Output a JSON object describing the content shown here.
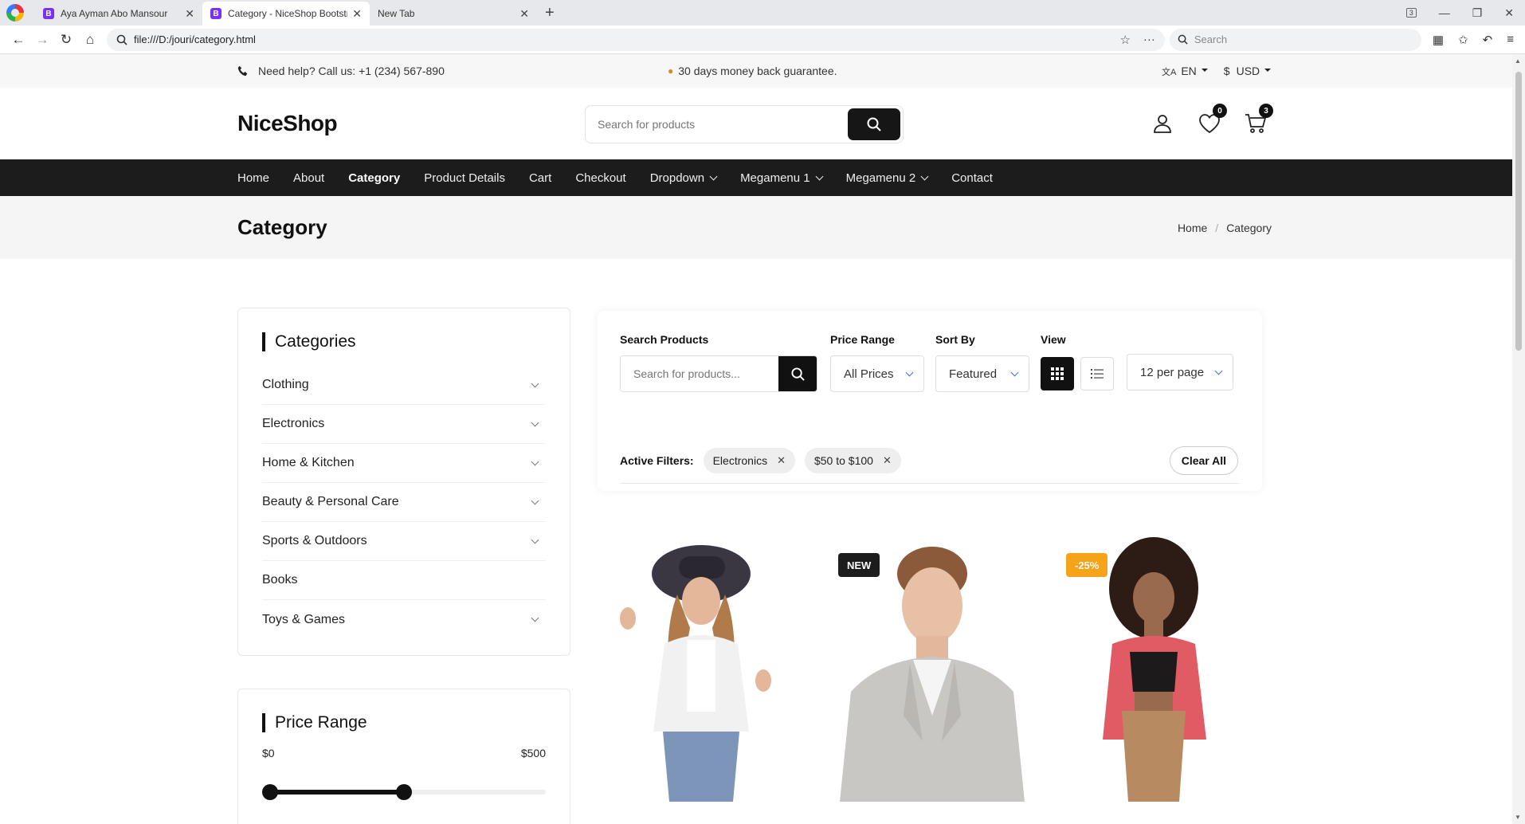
{
  "browser": {
    "tabs": [
      {
        "title": "Aya Ayman Abo Mansour",
        "favicon": "B",
        "active": false
      },
      {
        "title": "Category - NiceShop Bootstra",
        "favicon": "B",
        "active": true
      },
      {
        "title": "New Tab",
        "favicon": "",
        "active": false
      }
    ],
    "tab_counter": "3",
    "address": "file:///D:/jouri/category.html",
    "search_placeholder": "Search"
  },
  "topbar": {
    "help": "Need help? Call us: +1 (234) 567-890",
    "promo": "30 days money back guarantee.",
    "language": "EN",
    "currency_symbol": "$",
    "currency": "USD"
  },
  "header": {
    "logo": "NiceShop",
    "search_placeholder": "Search for products",
    "wishlist_count": "0",
    "cart_count": "3"
  },
  "nav": {
    "items": [
      "Home",
      "About",
      "Category",
      "Product Details",
      "Cart",
      "Checkout",
      "Dropdown",
      "Megamenu 1",
      "Megamenu 2",
      "Contact"
    ],
    "current": "Category"
  },
  "page": {
    "title": "Category",
    "breadcrumb": [
      "Home",
      "Category"
    ]
  },
  "categories": {
    "title": "Categories",
    "items": [
      "Clothing",
      "Electronics",
      "Home & Kitchen",
      "Beauty & Personal Care",
      "Sports & Outdoors",
      "Books",
      "Toys & Games"
    ]
  },
  "price_range": {
    "title": "Price Range",
    "min_label": "$0",
    "max_label": "$500",
    "range_min": 0,
    "range_max": 500,
    "selected_min": 0,
    "selected_max": 250
  },
  "filters": {
    "search_label": "Search Products",
    "search_placeholder": "Search for products...",
    "price_label": "Price Range",
    "price_value": "All Prices",
    "sort_label": "Sort By",
    "sort_value": "Featured",
    "view_label": "View",
    "view_mode": "grid",
    "per_page": "12 per page",
    "active_label": "Active Filters:",
    "active": [
      "Electronics",
      "$50 to $100"
    ],
    "clear_label": "Clear All"
  },
  "products": {
    "badges": {
      "new": "NEW",
      "sale": "-25%"
    }
  },
  "colors": {
    "dark": "#1c1c1c",
    "sale_badge": "#f5a318",
    "select_chevron": "#3a6fd8"
  }
}
